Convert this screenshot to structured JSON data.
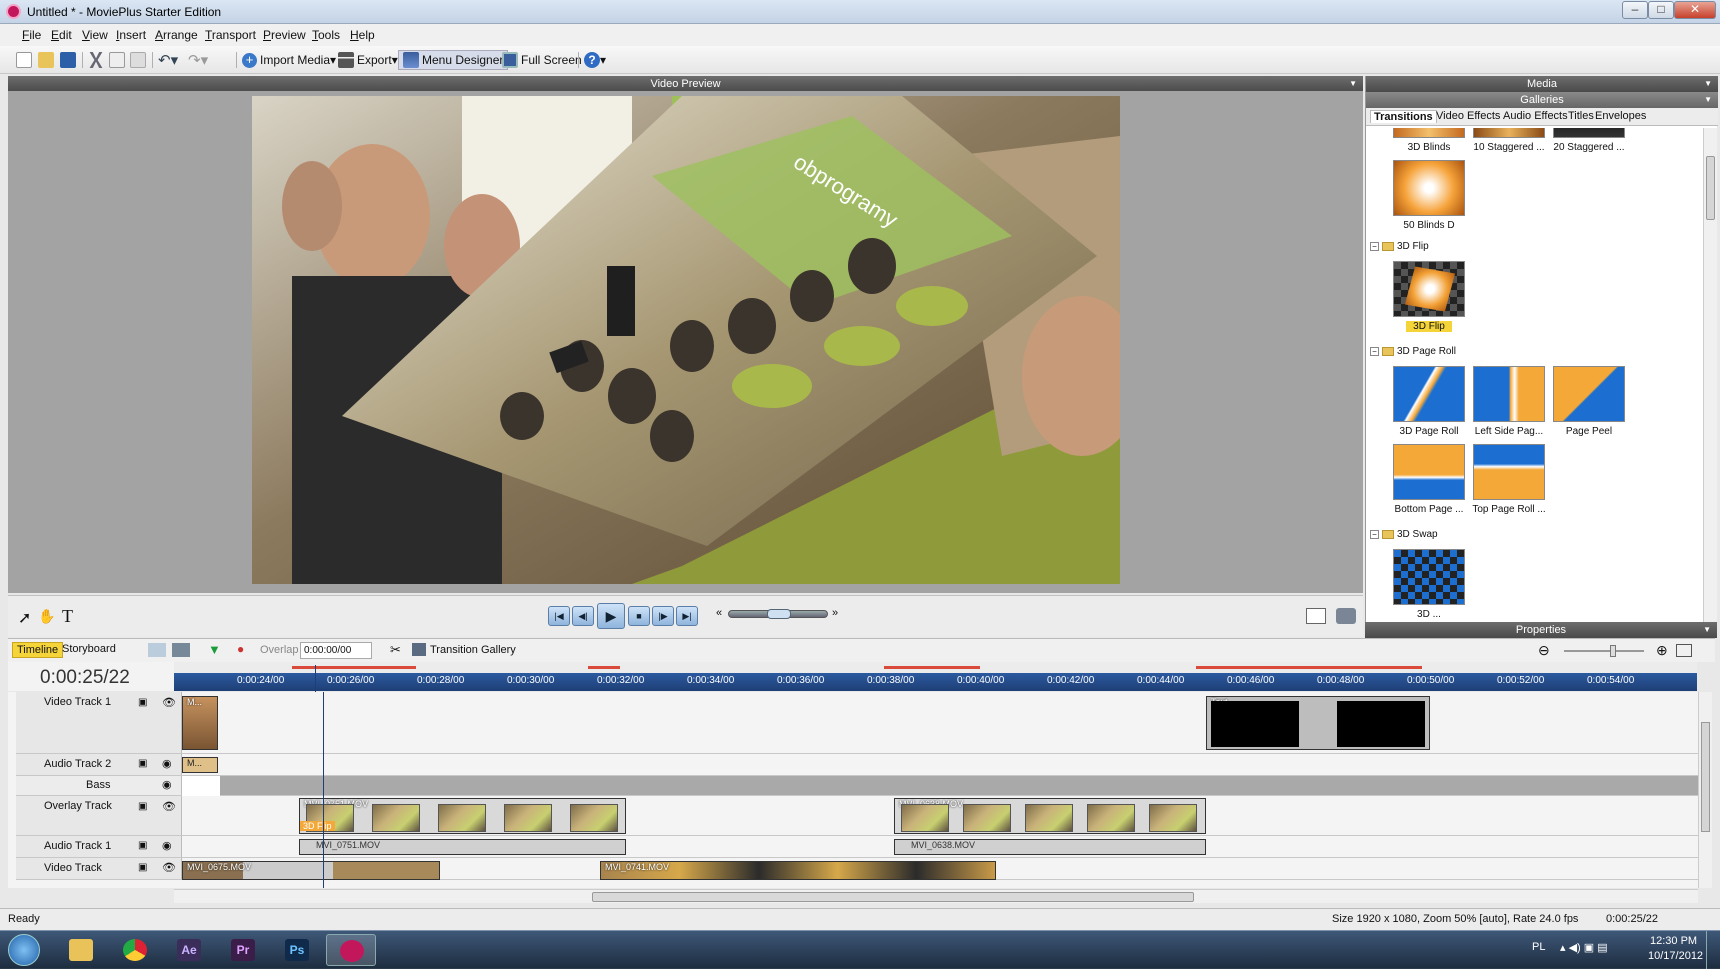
{
  "window": {
    "title": "Untitled * - MoviePlus Starter Edition",
    "minimize": "–",
    "maximize": "□",
    "close": "✕"
  },
  "menu": [
    "File",
    "Edit",
    "View",
    "Insert",
    "Arrange",
    "Transport",
    "Preview",
    "Tools",
    "Help"
  ],
  "toolbar": {
    "import_media": "Import Media",
    "export": "Export",
    "menu_designer": "Menu Designer",
    "full_screen": "Full Screen",
    "help": "?"
  },
  "video_preview": {
    "title": "Video Preview",
    "overlay_text": "obprogramy"
  },
  "media": {
    "title": "Media",
    "galleries_title": "Galleries",
    "tabs": [
      "Transitions",
      "Video Effects",
      "Audio Effects",
      "Titles",
      "Envelopes"
    ],
    "top_items": [
      "3D Blinds",
      "10 Staggered ...",
      "20 Staggered ..."
    ],
    "blinds_item": "50 Blinds D",
    "folders": [
      {
        "name": "3D Flip",
        "items": [
          "3D Flip"
        ]
      },
      {
        "name": "3D Page Roll",
        "items": [
          "3D Page Roll",
          "Left Side Pag...",
          "Page Peel",
          "Bottom Page ...",
          "Top Page Roll ..."
        ]
      },
      {
        "name": "3D Swap",
        "items": [
          "3D ..."
        ]
      }
    ],
    "properties_title": "Properties"
  },
  "timeline": {
    "tabs": [
      "Timeline",
      "Storyboard"
    ],
    "overlap_label": "Overlap",
    "overlap_value": "0:00:00/00",
    "transition_gallery": "Transition Gallery",
    "current_time": "0:00:25/22",
    "ruler": [
      "0:00:24/00",
      "0:00:26/00",
      "0:00:28/00",
      "0:00:30/00",
      "0:00:32/00",
      "0:00:34/00",
      "0:00:36/00",
      "0:00:38/00",
      "0:00:40/00",
      "0:00:42/00",
      "0:00:44/00",
      "0:00:46/00",
      "0:00:48/00",
      "0:00:50/00",
      "0:00:52/00",
      "0:00:54/00"
    ],
    "tracks": [
      "Video Track 1",
      "Audio Track 2",
      "Bass",
      "Overlay Track",
      "Audio Track 1",
      "Video Track"
    ],
    "clips": {
      "text": "Text",
      "overlay1": "MVI_0751.MOV",
      "overlay2": "MVI_0638.MOV",
      "audio1": "MVI_0751.MOV",
      "audio2": "MVI_0638.MOV",
      "video1": "MVI_0675.MOV",
      "video2": "MVI_0741.MOV",
      "transition": "3D Flip",
      "mini": "M...",
      "mini_audio": "M..."
    }
  },
  "status": {
    "left": "Ready",
    "info": "Size 1920 x 1080, Zoom 50% [auto], Rate 24.0 fps",
    "time": "0:00:25/22"
  },
  "taskbar": {
    "apps": [
      "Ae",
      "Pr",
      "Ps"
    ],
    "lang": "PL",
    "time": "12:30 PM",
    "date": "10/17/2012"
  }
}
